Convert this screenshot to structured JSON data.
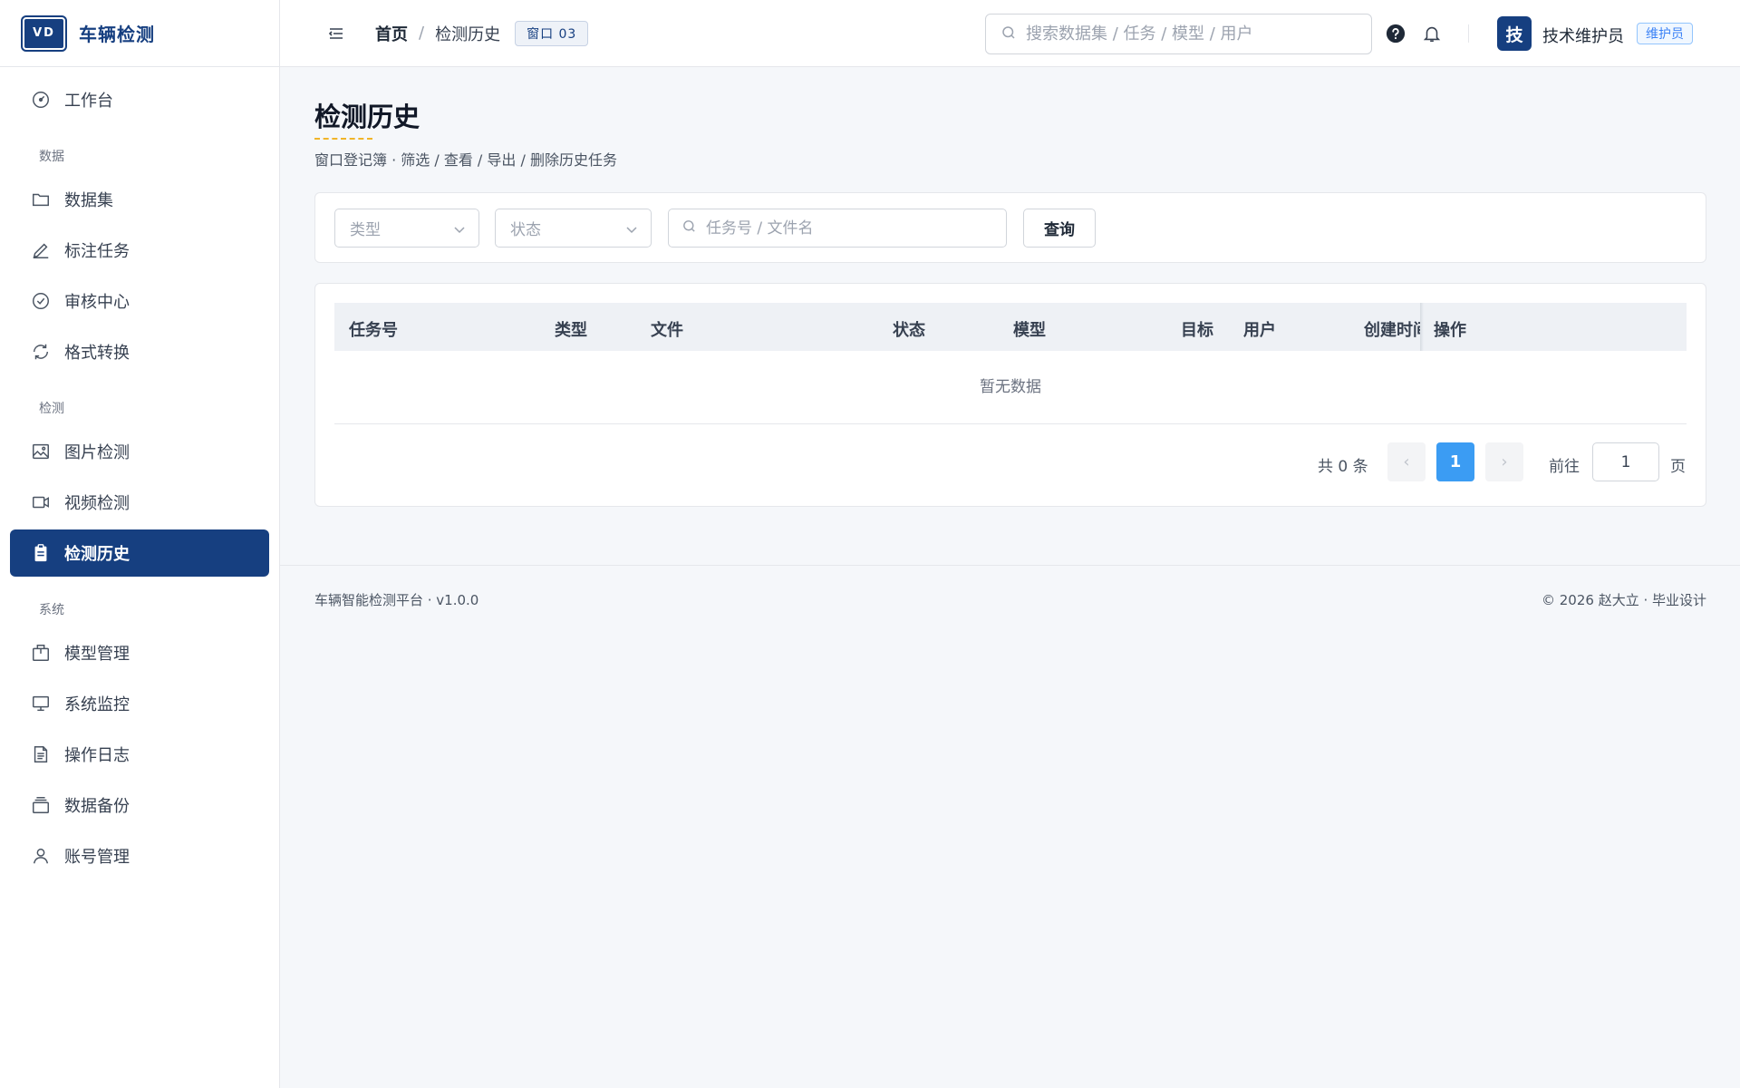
{
  "brand": {
    "logo": "VD",
    "name": "车辆检测"
  },
  "sidebar": {
    "items": [
      {
        "label": "工作台",
        "icon": "dashboard-icon"
      },
      {
        "group": "数据"
      },
      {
        "label": "数据集",
        "icon": "folder-icon"
      },
      {
        "label": "标注任务",
        "icon": "pen-icon"
      },
      {
        "label": "审核中心",
        "icon": "check-circle-icon"
      },
      {
        "label": "格式转换",
        "icon": "refresh-icon"
      },
      {
        "group": "检测"
      },
      {
        "label": "图片检测",
        "icon": "image-icon"
      },
      {
        "label": "视频检测",
        "icon": "video-icon"
      },
      {
        "label": "检测历史",
        "icon": "clipboard-icon",
        "active": true
      },
      {
        "group": "系统"
      },
      {
        "label": "模型管理",
        "icon": "box-icon"
      },
      {
        "label": "系统监控",
        "icon": "monitor-icon"
      },
      {
        "label": "操作日志",
        "icon": "document-icon"
      },
      {
        "label": "数据备份",
        "icon": "stack-icon"
      },
      {
        "label": "账号管理",
        "icon": "user-icon"
      }
    ]
  },
  "header": {
    "breadcrumb_home": "首页",
    "breadcrumb_sep": "/",
    "breadcrumb_current": "检测历史",
    "window_tag": "窗口 03",
    "search_placeholder": "搜索数据集 / 任务 / 模型 / 用户",
    "avatar": "技",
    "user_name": "技术维护员",
    "role_badge": "维护员"
  },
  "page": {
    "title": "检测历史",
    "subtitle": "窗口登记簿 · 筛选 / 查看 / 导出 / 删除历史任务"
  },
  "filters": {
    "type_placeholder": "类型",
    "status_placeholder": "状态",
    "keyword_placeholder": "任务号 / 文件名",
    "query_label": "查询"
  },
  "table": {
    "columns": [
      "任务号",
      "类型",
      "文件",
      "状态",
      "模型",
      "目标",
      "用户",
      "创建时间",
      "操作"
    ],
    "rows": [],
    "empty_text": "暂无数据"
  },
  "pagination": {
    "total_text": "共 0 条",
    "prev": "‹",
    "current_page": "1",
    "next": "›",
    "goto_label": "前往",
    "goto_value": "1",
    "page_unit": "页"
  },
  "footer": {
    "left": "车辆智能检测平台 · v1.0.0",
    "right": "© 2026 赵大立 · 毕业设计"
  },
  "colors": {
    "brand": "#163f80",
    "accent": "#3b9cf3",
    "title_underline": "#f0b429"
  }
}
